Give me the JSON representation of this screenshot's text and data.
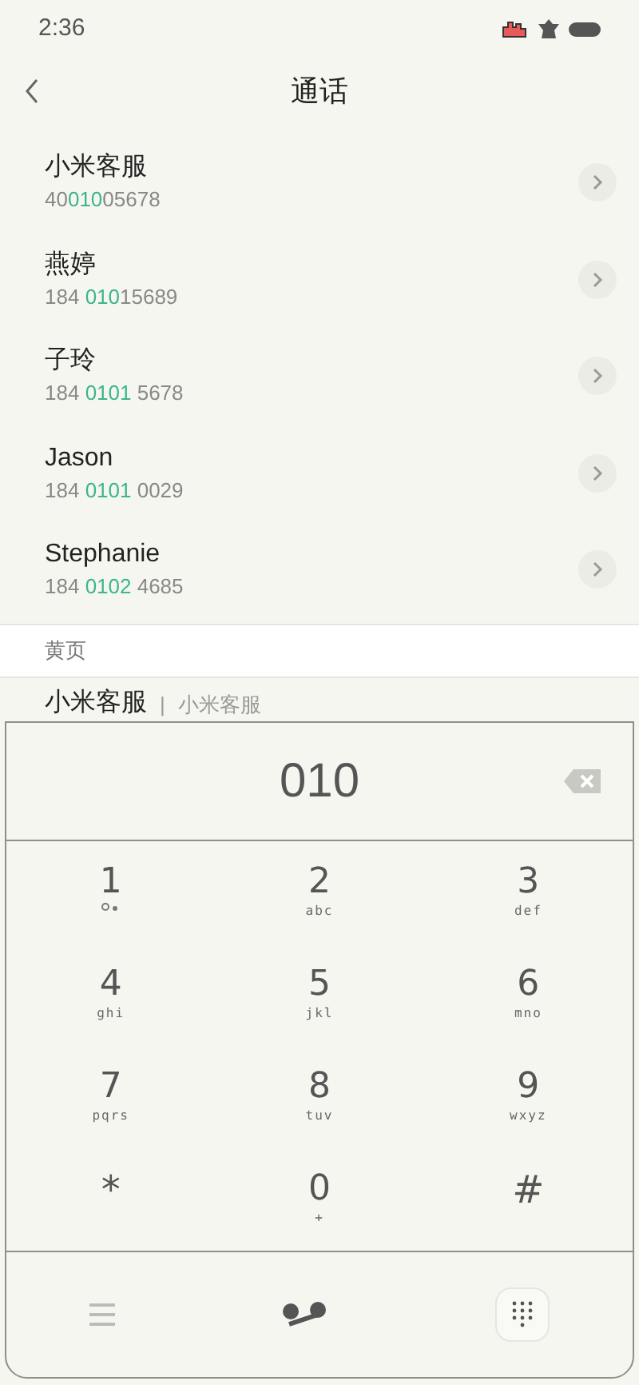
{
  "status_bar": {
    "time": "2:36"
  },
  "header": {
    "title": "通话"
  },
  "contacts": [
    {
      "name": "小米客服",
      "number_parts": [
        {
          "text": "40",
          "match": false
        },
        {
          "text": "010",
          "match": true
        },
        {
          "text": "05678",
          "match": false
        }
      ]
    },
    {
      "name": "燕婷",
      "number_parts": [
        {
          "text": "184 ",
          "match": false
        },
        {
          "text": "010",
          "match": true
        },
        {
          "text": "15689",
          "match": false
        }
      ]
    },
    {
      "name": "子玲",
      "number_parts": [
        {
          "text": "184 ",
          "match": false
        },
        {
          "text": "0101",
          "match": true
        },
        {
          "text": " 5678",
          "match": false
        }
      ]
    },
    {
      "name": "Jason",
      "number_parts": [
        {
          "text": "184 ",
          "match": false
        },
        {
          "text": "0101",
          "match": true
        },
        {
          "text": " 0029",
          "match": false
        }
      ]
    },
    {
      "name": "Stephanie",
      "number_parts": [
        {
          "text": "184 ",
          "match": false
        },
        {
          "text": "0102",
          "match": true
        },
        {
          "text": " 4685",
          "match": false
        }
      ]
    }
  ],
  "section": {
    "title": "黄页",
    "item": {
      "name": "小米客服",
      "separator": "|",
      "subtitle": "小米客服"
    }
  },
  "dialer": {
    "input": "010",
    "keys": [
      {
        "digit": "1",
        "kind": "voicemail"
      },
      {
        "digit": "2",
        "letters": "abc",
        "kind": "letters"
      },
      {
        "digit": "3",
        "letters": "def",
        "kind": "letters"
      },
      {
        "digit": "4",
        "letters": "ghi",
        "kind": "letters"
      },
      {
        "digit": "5",
        "letters": "jkl",
        "kind": "letters"
      },
      {
        "digit": "6",
        "letters": "mno",
        "kind": "letters"
      },
      {
        "digit": "7",
        "letters": "pqrs",
        "kind": "letters"
      },
      {
        "digit": "8",
        "letters": "tuv",
        "kind": "letters"
      },
      {
        "digit": "9",
        "letters": "wxyz",
        "kind": "letters"
      },
      {
        "digit": "*",
        "kind": "plain"
      },
      {
        "digit": "0",
        "letters": "+",
        "kind": "letters"
      },
      {
        "digit": "#",
        "kind": "plain"
      }
    ]
  }
}
